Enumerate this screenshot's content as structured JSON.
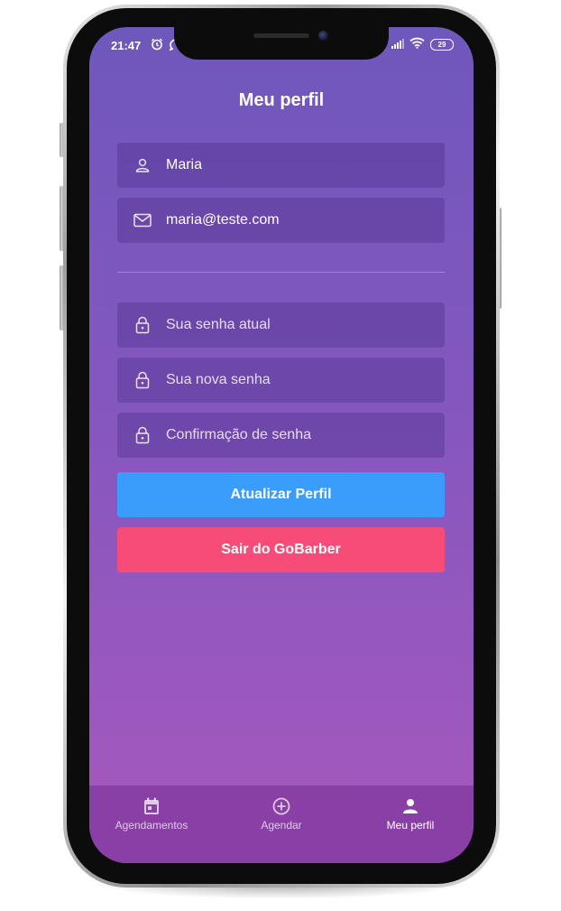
{
  "status_bar": {
    "time": "21:47",
    "battery": "29",
    "left_icons": [
      "alarm-icon",
      "whatsapp-icon"
    ],
    "right_icons": [
      "signal-icon",
      "wifi-icon",
      "battery-icon"
    ]
  },
  "header": {
    "title": "Meu perfil"
  },
  "form": {
    "name": {
      "icon": "user-icon",
      "value": "Maria"
    },
    "email": {
      "icon": "mail-icon",
      "value": "maria@teste.com"
    },
    "old_password": {
      "icon": "lock-icon",
      "placeholder": "Sua senha atual"
    },
    "new_password": {
      "icon": "lock-icon",
      "placeholder": "Sua nova senha"
    },
    "confirm_password": {
      "icon": "lock-icon",
      "placeholder": "Confirmação de senha"
    }
  },
  "actions": {
    "update_label": "Atualizar Perfil",
    "logout_label": "Sair do GoBarber"
  },
  "tabbar": {
    "tabs": [
      {
        "label": "Agendamentos",
        "icon": "calendar-icon",
        "active": false
      },
      {
        "label": "Agendar",
        "icon": "plus-circle-icon",
        "active": false
      },
      {
        "label": "Meu perfil",
        "icon": "person-icon",
        "active": true
      }
    ]
  },
  "colors": {
    "primary_button": "#3a9dfc",
    "danger_button": "#f74c77",
    "tabbar": "#8a3fa6",
    "gradient_top": "#6f57bc",
    "gradient_bottom": "#a758bd"
  }
}
